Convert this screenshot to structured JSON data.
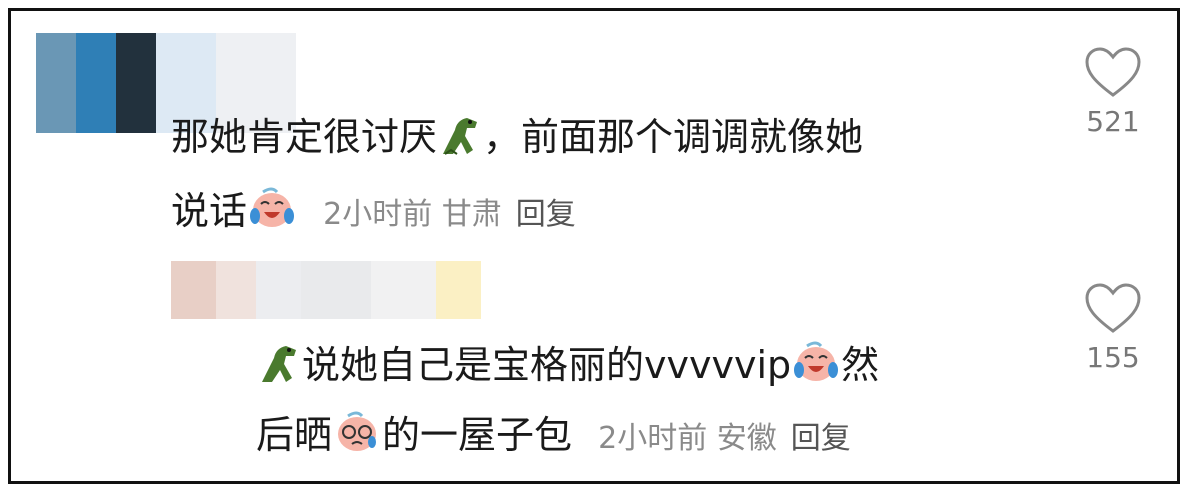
{
  "comments": [
    {
      "line1": [
        "那她肯定很讨厌",
        "，前面那个调调就像她"
      ],
      "line2": "说话",
      "time": "2小时前",
      "location": "甘肃",
      "reply_label": "回复",
      "likes": "521"
    },
    {
      "line1": [
        "说她自己是宝格丽的vvvvvip",
        "然"
      ],
      "line2": [
        "后晒",
        "的一屋子包"
      ],
      "time": "2小时前",
      "location": "安徽",
      "reply_label": "回复",
      "likes": "155"
    }
  ],
  "icons": {
    "like": "heart-outline-icon",
    "crocodile": "crocodile-emoji-icon",
    "laugh": "laugh-cry-emoji-icon"
  },
  "colors": {
    "text": "#1a1a1a",
    "meta": "#8a8a8a",
    "icon": "#888888"
  }
}
